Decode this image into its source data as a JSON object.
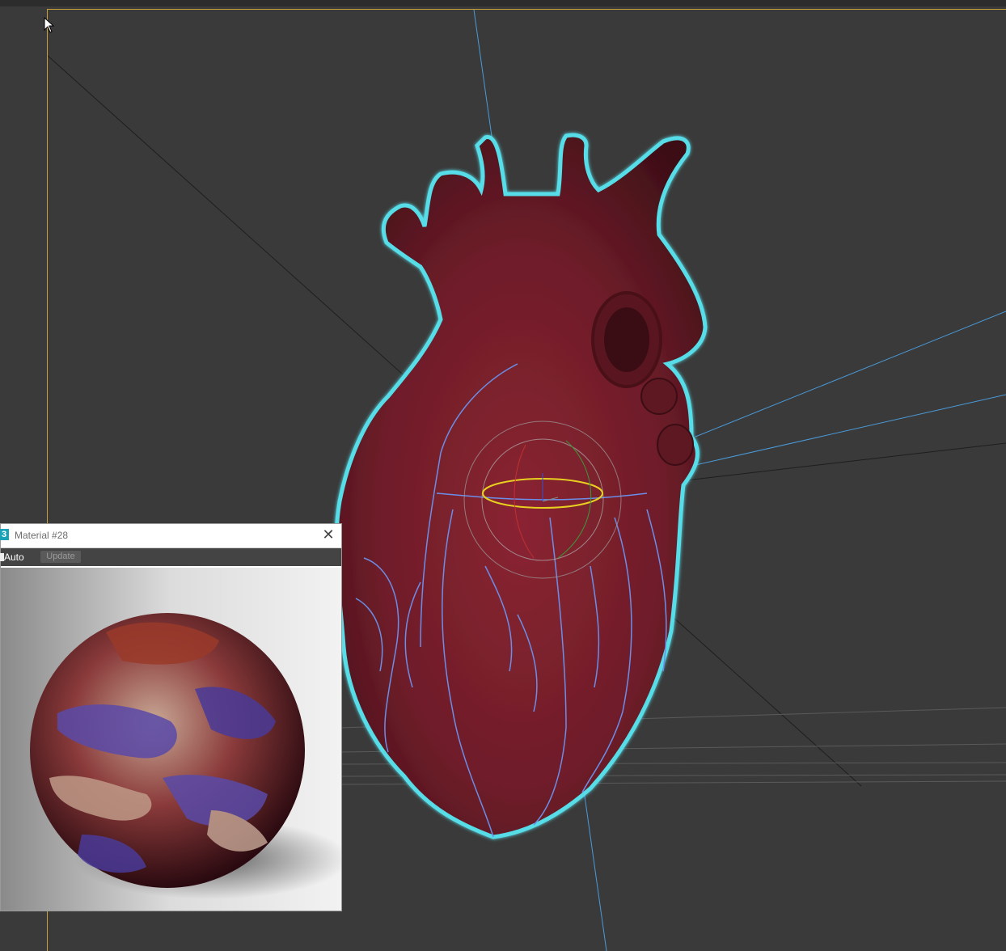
{
  "material_editor": {
    "title": "Material #28",
    "app_icon": "3",
    "close_symbol": "✕",
    "auto_label": "Auto",
    "update_label": "Update"
  },
  "viewport": {
    "object": "heart-model",
    "background_color": "#3a3a3a",
    "selection_outline_color": "#56dde8",
    "model_color": "#6e1d29",
    "vein_outline_color": "#6b8ee8",
    "frame_color": "#c8a03a"
  },
  "icons": {
    "cursor": "arrow-cursor-icon",
    "close": "close-icon",
    "app": "3dsmax-icon",
    "gizmo": "rotate-gizmo-icon"
  }
}
